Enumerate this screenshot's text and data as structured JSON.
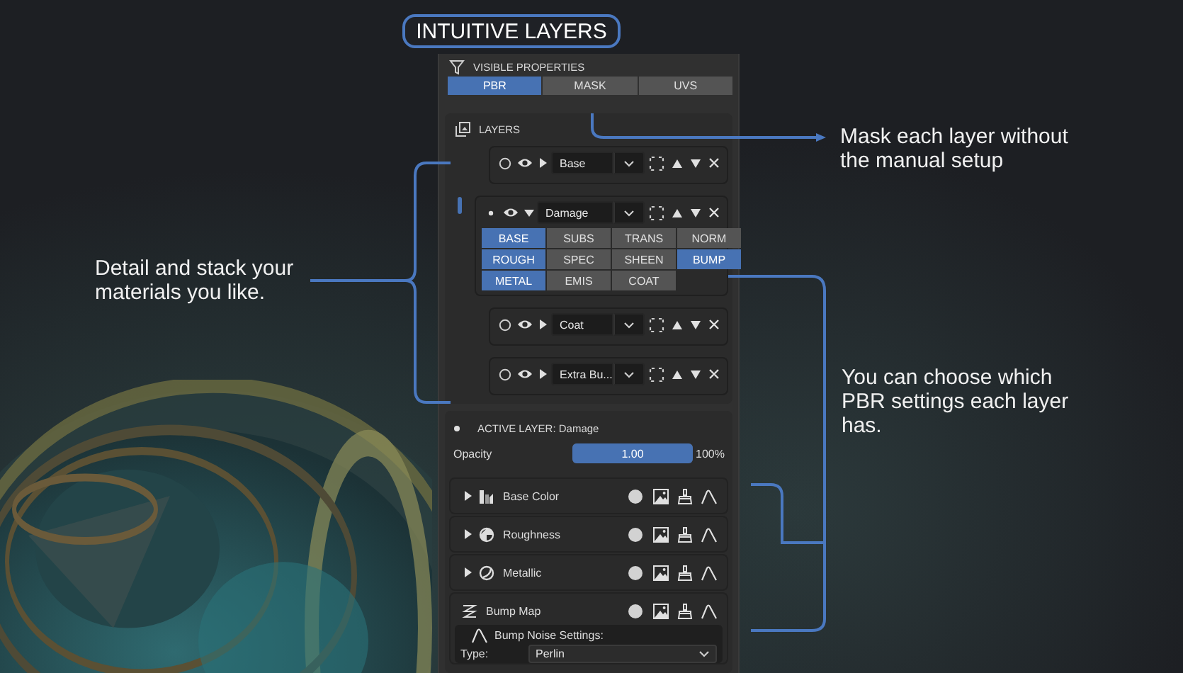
{
  "title": "INTUITIVE LAYERS",
  "visible_properties": {
    "label": "VISIBLE PROPERTIES",
    "tabs": [
      {
        "label": "PBR",
        "selected": true
      },
      {
        "label": "MASK",
        "selected": false
      },
      {
        "label": "UVS",
        "selected": false
      }
    ]
  },
  "layers": {
    "label": "LAYERS",
    "items": [
      {
        "name": "Base",
        "active": false,
        "visible": true,
        "expanded": false
      },
      {
        "name": "Damage",
        "active": true,
        "visible": true,
        "expanded": true,
        "channels": [
          {
            "label": "BASE",
            "selected": true
          },
          {
            "label": "SUBS",
            "selected": false
          },
          {
            "label": "TRANS",
            "selected": false
          },
          {
            "label": "NORM",
            "selected": false
          },
          {
            "label": "ROUGH",
            "selected": true
          },
          {
            "label": "SPEC",
            "selected": false
          },
          {
            "label": "SHEEN",
            "selected": false
          },
          {
            "label": "BUMP",
            "selected": true
          },
          {
            "label": "METAL",
            "selected": true
          },
          {
            "label": "EMIS",
            "selected": false
          },
          {
            "label": "COAT",
            "selected": false
          }
        ]
      },
      {
        "name": "Coat",
        "active": false,
        "visible": true,
        "expanded": false
      },
      {
        "name": "Extra Bu...",
        "active": false,
        "visible": true,
        "expanded": false
      }
    ]
  },
  "active_layer": {
    "title": "ACTIVE LAYER: Damage",
    "opacity": {
      "label": "Opacity",
      "value": "1.00",
      "level": 1.0,
      "percent": "100%"
    },
    "channels": [
      {
        "name": "Base Color",
        "expanded": false
      },
      {
        "name": "Roughness",
        "expanded": false
      },
      {
        "name": "Metallic",
        "expanded": false
      },
      {
        "name": "Bump Map",
        "expanded": true,
        "settings": {
          "title": "Bump Noise Settings:",
          "type_label": "Type:",
          "type_value": "Perlin"
        }
      }
    ]
  },
  "callouts": [
    {
      "text": "Mask each layer without the manual setup"
    },
    {
      "text": "Detail and stack your materials you like."
    },
    {
      "text": "You can choose which PBR settings each layer has."
    }
  ]
}
